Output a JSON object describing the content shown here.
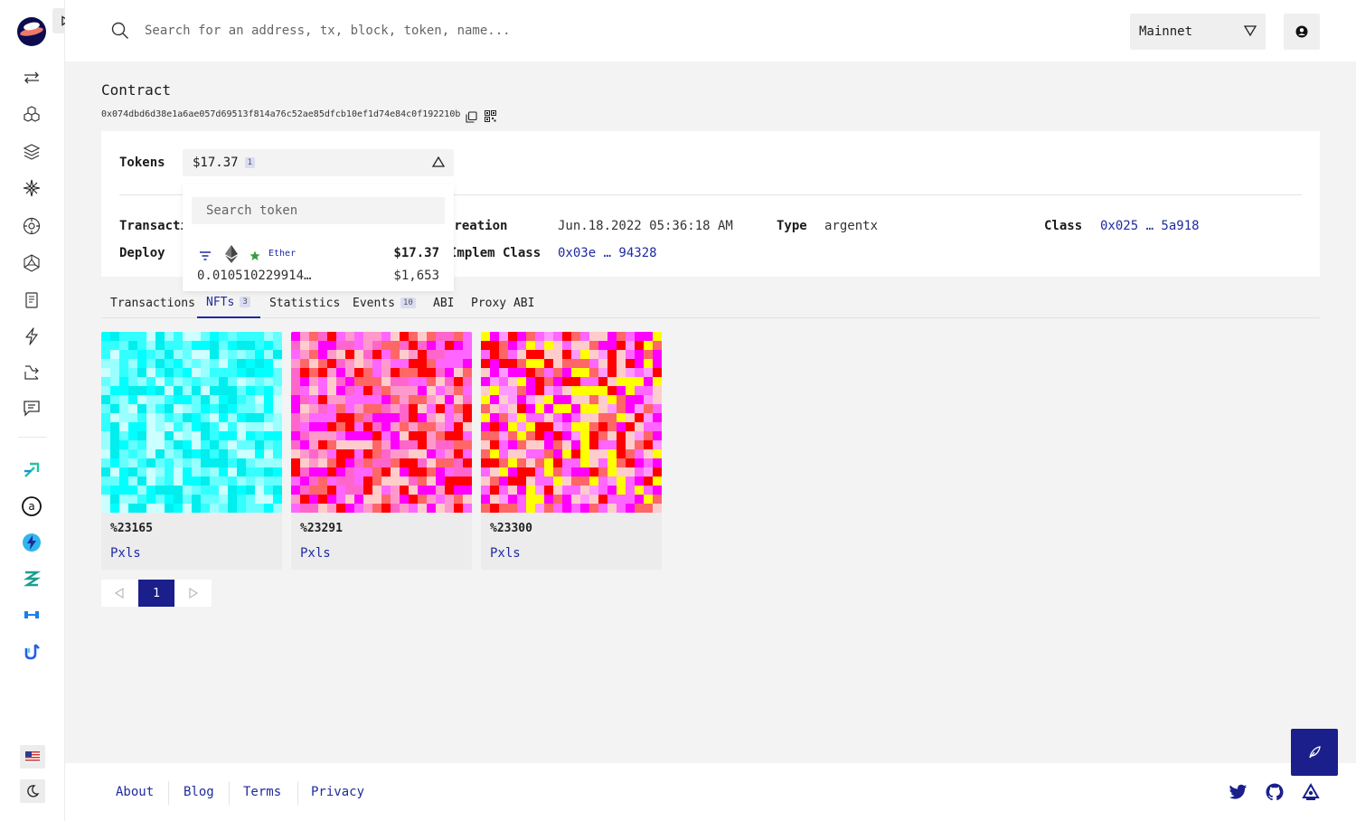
{
  "header": {
    "search_placeholder": "Search for an address, tx, block, token, name...",
    "network": "Mainnet"
  },
  "contract": {
    "title": "Contract",
    "address": "0x074dbd6d38e1a6ae057d69513f814a76c52ae85dfcb10ef1d74e84c0f192210b"
  },
  "overview": {
    "tokens_label": "Tokens",
    "tokens_value": "$17.37",
    "tokens_count": "1",
    "rows": {
      "transaction_label": "Transacti",
      "deploy_label": "Deploy",
      "creation_label": "Creation",
      "creation_value": "Jun.18.2022 05:36:18 AM",
      "type_label": "Type",
      "type_value": "argentx",
      "class_label": "Class",
      "class_value": "0x025 … 5a918",
      "implem_label": "Implem Class",
      "implem_value": "0x03e … 94328"
    }
  },
  "token_dropdown": {
    "search_placeholder": "Search token",
    "token": {
      "name": "Ether",
      "usd": "$17.37",
      "amount": "0.010510229914…",
      "price": "$1,653"
    }
  },
  "tabs": [
    {
      "label": "Transactions"
    },
    {
      "label": "NFTs",
      "badge": "3"
    },
    {
      "label": "Statistics"
    },
    {
      "label": "Events",
      "badge": "10"
    },
    {
      "label": "ABI"
    },
    {
      "label": "Proxy ABI"
    }
  ],
  "nfts": [
    {
      "id": "%23165",
      "collection": "Pxls",
      "palette": [
        "#00ffff",
        "#33ffff",
        "#66ffff",
        "#99ffff",
        "#ccffff",
        "#00eeee"
      ]
    },
    {
      "id": "%23291",
      "collection": "Pxls",
      "palette": [
        "#ff00ff",
        "#ff66cc",
        "#ff0000",
        "#ff99cc",
        "#ff66ff",
        "#ffcccc",
        "#ff6666"
      ]
    },
    {
      "id": "%23300",
      "collection": "Pxls",
      "palette": [
        "#ffff00",
        "#ff00ff",
        "#ff0000",
        "#ff99ff",
        "#ff6666",
        "#ffcccc",
        "#ff66ff"
      ]
    }
  ],
  "pagination": {
    "current": "1"
  },
  "footer": {
    "links": [
      "About",
      "Blog",
      "Terms",
      "Privacy"
    ]
  },
  "colors": {
    "accent": "#1f2aa0",
    "accent_dark": "#1a1f8c"
  }
}
